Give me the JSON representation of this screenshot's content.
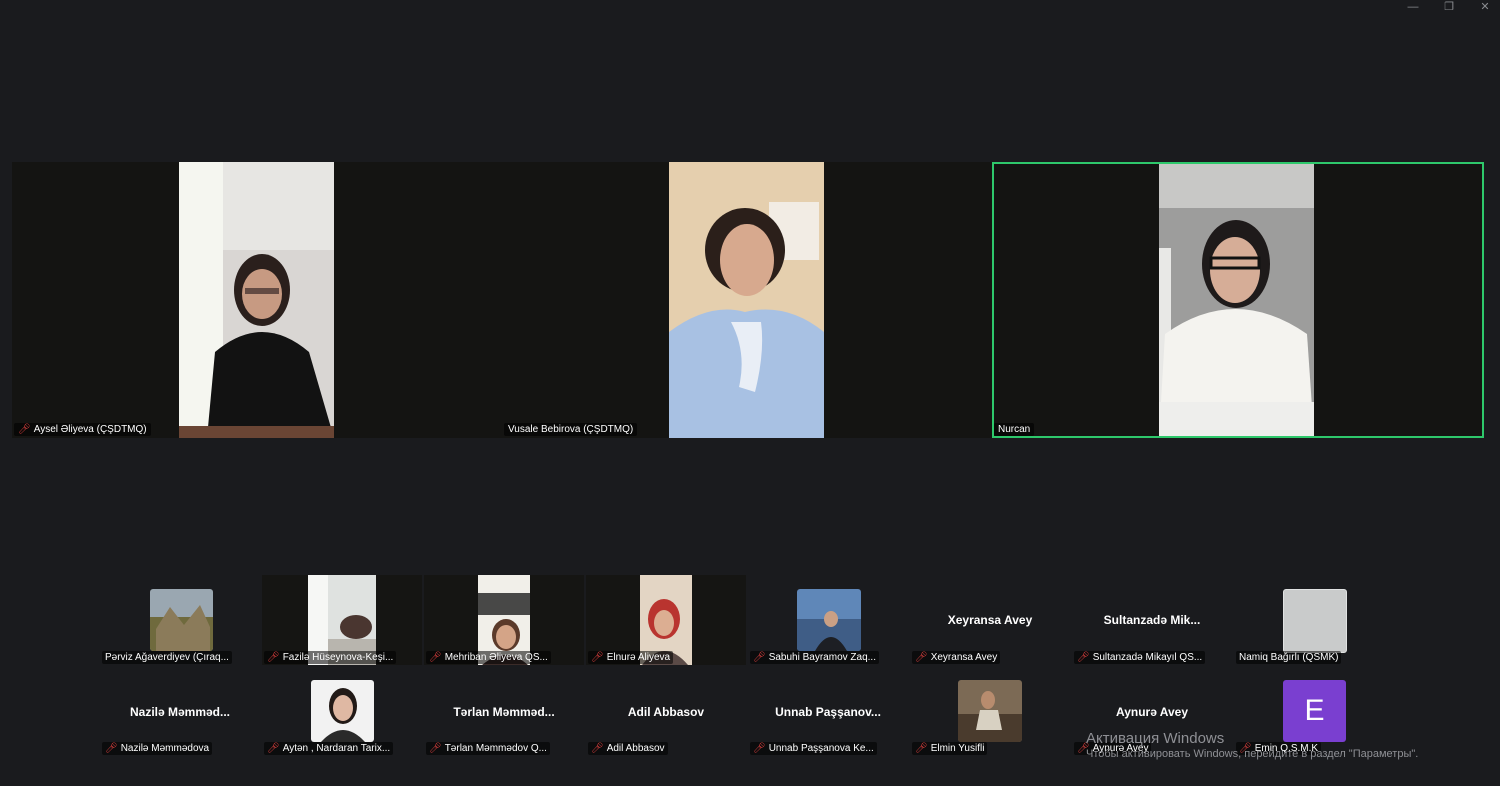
{
  "window_controls": {
    "minimize": "—",
    "restore": "❐",
    "close": "✕"
  },
  "main_tiles": [
    {
      "name": "Aysel Əliyeva (ÇŞDTMQ)",
      "muted": true,
      "active": false
    },
    {
      "name": "Vusale Bebirova (ÇŞDTMQ)",
      "muted": false,
      "active": false
    },
    {
      "name": "Nurcan",
      "muted": false,
      "active": true
    }
  ],
  "gallery": [
    {
      "name": "Pərviz Ağaverdiyev (Çıraq...",
      "muted": false
    },
    {
      "name": "Fazilə Hüseynova-Keşi...",
      "muted": true
    },
    {
      "name": "Mehriban Əliyeva QS...",
      "muted": true
    },
    {
      "name": "Elnurə  Aliyeva",
      "muted": true
    },
    {
      "name": "Sabuhi Bayramov Zaq...",
      "muted": true
    },
    {
      "name": "Xeyransa Avey",
      "display": "Xeyransa Avey",
      "muted": true
    },
    {
      "name": "Sultanzadə Mikayıl QS...",
      "display": "Sultanzadə  Mik...",
      "muted": true
    },
    {
      "name": "Namiq Bağırlı (QSMK)",
      "muted": false
    },
    {
      "name": "Nazilə Məmmədova",
      "display": "Nazilə  Məmməd...",
      "muted": true
    },
    {
      "name": "Aytən , Nardaran Tarix...",
      "muted": true
    },
    {
      "name": "Tərlan Məmmədov Q...",
      "display": "Tərlan  Məmməd...",
      "muted": true
    },
    {
      "name": "Adil Abbasov",
      "display": "Adil Abbasov",
      "muted": true
    },
    {
      "name": "Unnab Paşşanova  Ke...",
      "display": "Unnab  Paşşanov...",
      "muted": true
    },
    {
      "name": "Elmin Yusifli",
      "muted": true
    },
    {
      "name": "Aynurə Avey",
      "display": "Aynurə Avey",
      "muted": true
    },
    {
      "name": "Emin Q.S.M.K",
      "avatar_letter": "E",
      "avatar_color": "#7a3fd0",
      "muted": true
    }
  ],
  "watermark": {
    "line1": "Активация Windows",
    "line2": "Чтобы активировать Windows, перейдите в раздел \"Параметры\"."
  },
  "colors": {
    "active_speaker": "#2ec86b",
    "muted_mic": "#e4403f"
  }
}
